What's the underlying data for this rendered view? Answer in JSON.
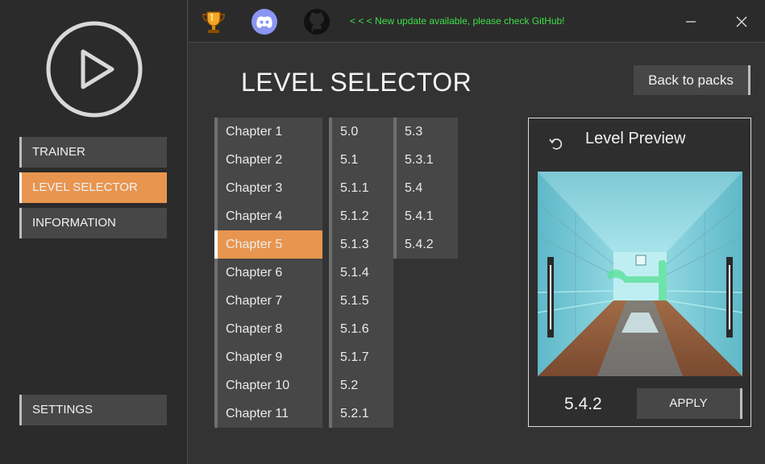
{
  "sidebar": {
    "logo_icon": "play-circle-icon",
    "items": [
      {
        "label": "TRAINER"
      },
      {
        "label": "LEVEL SELECTOR"
      },
      {
        "label": "INFORMATION"
      }
    ],
    "settings_label": "SETTINGS"
  },
  "topbar": {
    "icons": [
      "trophy-icon",
      "discord-icon",
      "github-icon"
    ],
    "update_text": "< < < New update available, please check GitHub!",
    "window_controls": [
      "minimize-icon",
      "close-icon"
    ]
  },
  "main": {
    "title": "LEVEL SELECTOR",
    "back_label": "Back to packs",
    "chapters": [
      "Chapter 1",
      "Chapter 2",
      "Chapter 3",
      "Chapter 4",
      "Chapter 5",
      "Chapter 6",
      "Chapter 7",
      "Chapter 8",
      "Chapter 9",
      "Chapter 10",
      "Chapter 11"
    ],
    "selected_chapter": "Chapter 5",
    "levels_col1": [
      "5.0",
      "5.1",
      "5.1.1",
      "5.1.2",
      "5.1.3",
      "5.1.4",
      "5.1.5",
      "5.1.6",
      "5.1.7",
      "5.2",
      "5.2.1"
    ],
    "levels_col2": [
      "5.3",
      "5.3.1",
      "5.4",
      "5.4.1",
      "5.4.2"
    ]
  },
  "preview": {
    "title": "Level Preview",
    "level": "5.4.2",
    "apply_label": "APPLY"
  },
  "colors": {
    "accent": "#e8954f",
    "background": "#333333",
    "sidebar": "#2b2b2b",
    "panel": "#474747",
    "update_text": "#3ee04a"
  }
}
